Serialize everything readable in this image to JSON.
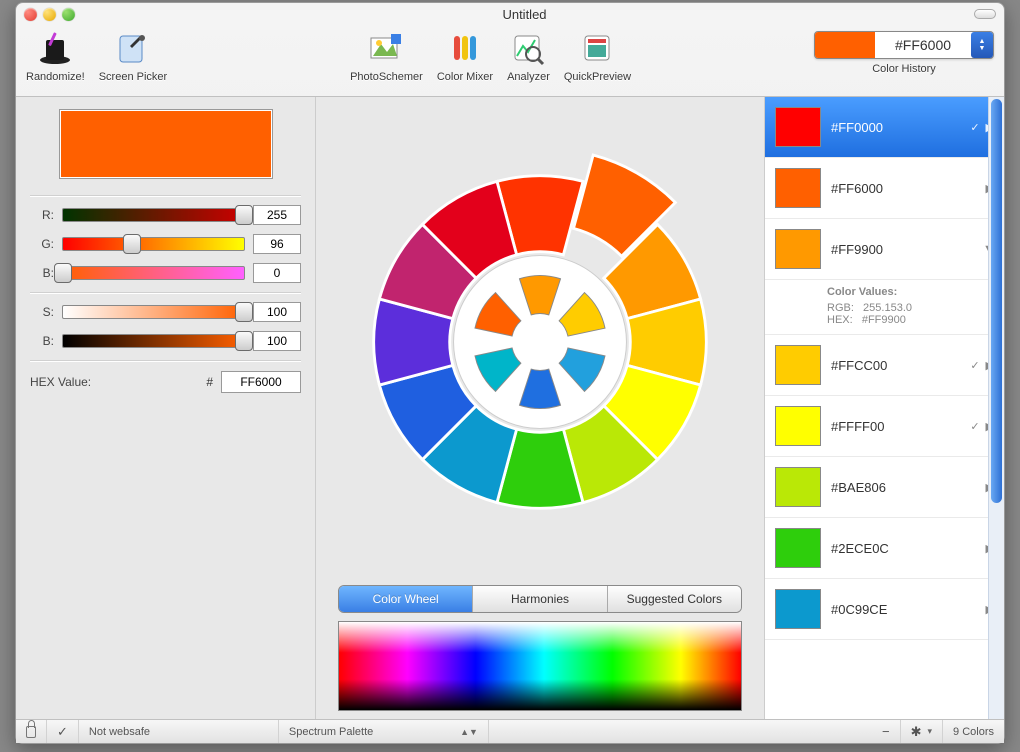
{
  "window": {
    "title": "Untitled"
  },
  "toolbar": {
    "randomize": "Randomize!",
    "screen_picker": "Screen Picker",
    "photoschemer": "PhotoSchemer",
    "color_mixer": "Color Mixer",
    "analyzer": "Analyzer",
    "quickpreview": "QuickPreview",
    "history_label": "Color History",
    "history_value": "#FF6000",
    "history_swatch": "#FF6000"
  },
  "sliders": {
    "r_label": "R:",
    "r_value": "255",
    "g_label": "G:",
    "g_value": "96",
    "b_label": "B:",
    "b_value": "0",
    "s_label": "S:",
    "s_value": "100",
    "br_label": "B:",
    "br_value": "100",
    "hex_label": "HEX Value:",
    "hash": "#",
    "hex_value": "FF6000"
  },
  "current_swatch": "#FF6000",
  "tabs": {
    "wheel": "Color Wheel",
    "harmonies": "Harmonies",
    "suggested": "Suggested Colors"
  },
  "history_items": [
    {
      "hex": "#FF0000",
      "color": "#FF0000",
      "checked": true,
      "open": false,
      "selected": true
    },
    {
      "hex": "#FF6000",
      "color": "#FF6000",
      "checked": false,
      "open": false
    },
    {
      "hex": "#FF9900",
      "color": "#FF9900",
      "checked": false,
      "open": true
    },
    {
      "hex": "#FFCC00",
      "color": "#FFCC00",
      "checked": true,
      "open": false
    },
    {
      "hex": "#FFFF00",
      "color": "#FFFF00",
      "checked": true,
      "open": false
    },
    {
      "hex": "#BAE806",
      "color": "#BAE806",
      "checked": false,
      "open": false
    },
    {
      "hex": "#2ECE0C",
      "color": "#2ECE0C",
      "checked": false,
      "open": false
    },
    {
      "hex": "#0C99CE",
      "color": "#0C99CE",
      "checked": false,
      "open": false
    }
  ],
  "details": {
    "title": "Color Values:",
    "rgb_label": "RGB:",
    "rgb": "255.153.0",
    "hex_label": "HEX:",
    "hex": "#FF9900"
  },
  "status": {
    "websafe": "Not websafe",
    "palette": "Spectrum Palette",
    "count": "9 Colors"
  },
  "wheel_colors": [
    "#FF3300",
    "#FF6000",
    "#FF9900",
    "#FFCC00",
    "#FFFF00",
    "#BAE806",
    "#2ECE0C",
    "#0C99CE",
    "#1F5FE0",
    "#5C2EDB",
    "#C1246E",
    "#E3001B"
  ],
  "inner_colors": [
    "#FF6000",
    "#FF9900",
    "#FFCC00",
    "#22A0DD",
    "#1F6FE0",
    "#00B5C9"
  ]
}
